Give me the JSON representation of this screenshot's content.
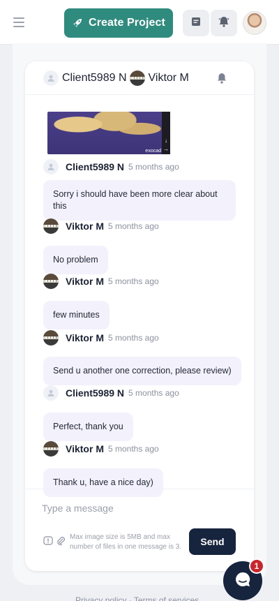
{
  "topbar": {
    "create_label": "Create Project"
  },
  "chat": {
    "header": {
      "participant1": "Client5989 N",
      "participant2": "Viktor M"
    },
    "attachment_label": "exocad",
    "messages": [
      {
        "author": "Client5989 N",
        "time": "5 months ago",
        "text": "Sorry i should have been more clear about this"
      },
      {
        "author": "Viktor M",
        "time": "5 months ago",
        "text": "No problem"
      },
      {
        "author": "Viktor M",
        "time": "5 months ago",
        "text": "few minutes"
      },
      {
        "author": "Viktor M",
        "time": "5 months ago",
        "text": "Send u another one correction, please review)"
      },
      {
        "author": "Client5989 N",
        "time": "5 months ago",
        "text": "Perfect, thank you"
      },
      {
        "author": "Viktor M",
        "time": "5 months ago",
        "text": "Thank u, have a nice day)"
      }
    ]
  },
  "composer": {
    "placeholder": "Type a message",
    "hint": "Max image size is 5MB and max number of files in one message is 3.",
    "send_label": "Send"
  },
  "chat_widget": {
    "badge_count": "1"
  },
  "footer": {
    "privacy": "Privacy policy",
    "separator": "·",
    "terms": "Terms of services"
  },
  "colors": {
    "brand_green": "#2e8b7e",
    "navy": "#16253d",
    "bubble": "#f3f1fb",
    "badge_red": "#c9252b"
  }
}
